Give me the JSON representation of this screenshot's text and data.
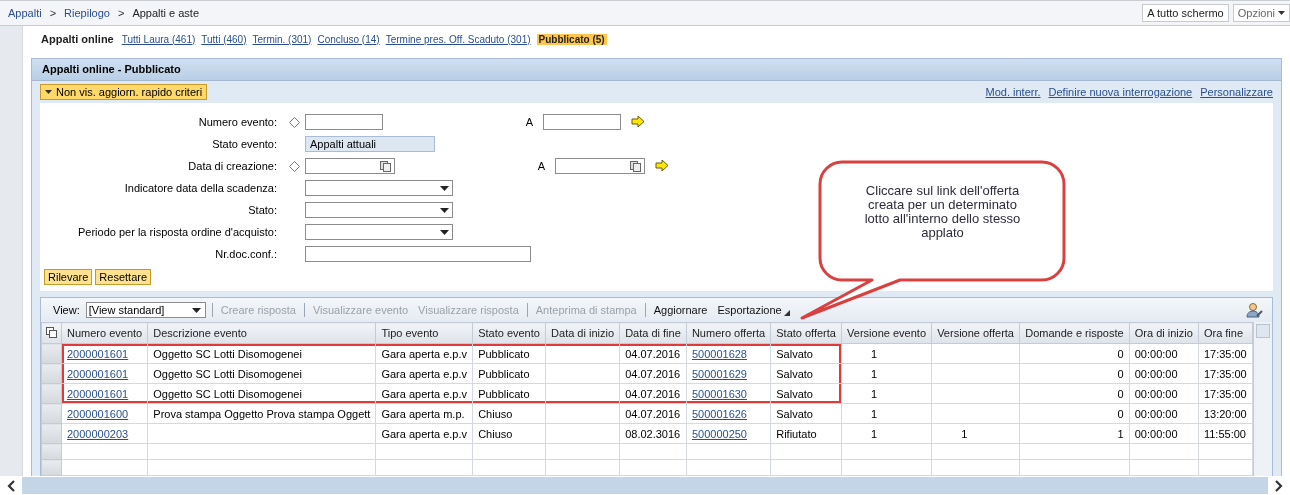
{
  "breadcrumb": {
    "separator": ">",
    "items": [
      "Appalti",
      "Riepilogo",
      "Appalti e aste"
    ]
  },
  "header_buttons": [
    {
      "label": "A tutto schermo",
      "kind": "plain"
    },
    {
      "label": "Opzioni",
      "kind": "menu"
    }
  ],
  "tab_strip": {
    "label": "Appalti online",
    "tabs": [
      {
        "label": "Tutti Laura (461)",
        "selected": false
      },
      {
        "label": "Tutti (460)",
        "selected": false
      },
      {
        "label": "Termin. (301)",
        "selected": false
      },
      {
        "label": "Concluso (14)",
        "selected": false
      },
      {
        "label": "Termine pres. Off. Scaduto (301)",
        "selected": false
      },
      {
        "label": "Pubblicato (5)",
        "selected": true
      }
    ]
  },
  "panel": {
    "title": "Appalti online - Pubblicato",
    "toggle": "Non vis. aggiorn. rapido criteri",
    "links": [
      "Mod. interr.",
      "Definire nuova interrogazione",
      "Personalizzare"
    ],
    "fields": [
      {
        "label": "Numero evento:",
        "kind": "range",
        "to_label": "A"
      },
      {
        "label": "Stato evento:",
        "kind": "display",
        "value": "Appalti attuali"
      },
      {
        "label": "Data di creazione:",
        "kind": "date-range",
        "to_label": "A"
      },
      {
        "label": "Indicatore data della scadenza:",
        "kind": "select"
      },
      {
        "label": "Stato:",
        "kind": "select"
      },
      {
        "label": "Periodo per la risposta ordine d'acquisto:",
        "kind": "select"
      },
      {
        "label": "Nr.doc.conf.:",
        "kind": "text"
      }
    ],
    "buttons": [
      "Rilevare",
      "Resettare"
    ]
  },
  "table": {
    "view_label": "View:",
    "view_value": "[View standard]",
    "actions": [
      {
        "label": "Creare risposta",
        "disabled": true,
        "kind": "plain"
      },
      {
        "label": "Visualizzare evento",
        "disabled": true,
        "kind": "plain"
      },
      {
        "label": "Visualizzare risposta",
        "disabled": true,
        "kind": "plain"
      },
      {
        "label": "Anteprima di stampa",
        "disabled": true,
        "kind": "plain"
      },
      {
        "label": "Aggiornare",
        "disabled": false,
        "kind": "plain"
      },
      {
        "label": "Esportazione",
        "disabled": false,
        "kind": "menu"
      }
    ],
    "columns": [
      {
        "label": "Numero evento",
        "kind": "link"
      },
      {
        "label": "Descrizione evento",
        "kind": "text"
      },
      {
        "label": "Tipo evento",
        "kind": "text"
      },
      {
        "label": "Stato evento",
        "kind": "text"
      },
      {
        "label": "Data di inizio",
        "kind": "text"
      },
      {
        "label": "Data di fine",
        "kind": "text"
      },
      {
        "label": "Numero offerta",
        "kind": "link"
      },
      {
        "label": "Stato offerta",
        "kind": "text"
      },
      {
        "label": "Versione evento",
        "kind": "count"
      },
      {
        "label": "Versione offerta",
        "kind": "count"
      },
      {
        "label": "Domande e risposte",
        "kind": "number"
      },
      {
        "label": "Ora di inizio",
        "kind": "text"
      },
      {
        "label": "Ora fine",
        "kind": "text"
      }
    ],
    "rows": [
      {
        "highlighted": true,
        "cells": [
          "2000001601",
          "Oggetto SC Lotti Disomogenei",
          "Gara aperta e.p.v",
          "Pubblicato",
          "",
          "04.07.2016",
          "500001628",
          "Salvato",
          "1",
          "",
          "0",
          "00:00:00",
          "17:35:00"
        ]
      },
      {
        "highlighted": true,
        "cells": [
          "2000001601",
          "Oggetto SC Lotti Disomogenei",
          "Gara aperta e.p.v",
          "Pubblicato",
          "",
          "04.07.2016",
          "500001629",
          "Salvato",
          "1",
          "",
          "0",
          "00:00:00",
          "17:35:00"
        ]
      },
      {
        "highlighted": true,
        "cells": [
          "2000001601",
          "Oggetto SC Lotti Disomogenei",
          "Gara aperta e.p.v",
          "Pubblicato",
          "",
          "04.07.2016",
          "500001630",
          "Salvato",
          "1",
          "",
          "0",
          "00:00:00",
          "17:35:00"
        ]
      },
      {
        "highlighted": false,
        "cells": [
          "2000001600",
          "Prova stampa Oggetto Prova stampa Oggett",
          "Gara aperta m.p.",
          "Chiuso",
          "",
          "04.07.2016",
          "500001626",
          "Salvato",
          "1",
          "",
          "0",
          "00:00:00",
          "13:20:00"
        ]
      },
      {
        "highlighted": false,
        "cells": [
          "2000000203",
          "",
          "Gara aperta e.p.v",
          "Chiuso",
          "",
          "08.02.3016",
          "500000250",
          "Rifiutato",
          "1",
          "1",
          "1",
          "00:00:00",
          "11:55:00"
        ]
      }
    ]
  },
  "callout": {
    "text": "Cliccare sul link dell'offerta creata per un determinato lotto all'interno dello stesso applato"
  }
}
